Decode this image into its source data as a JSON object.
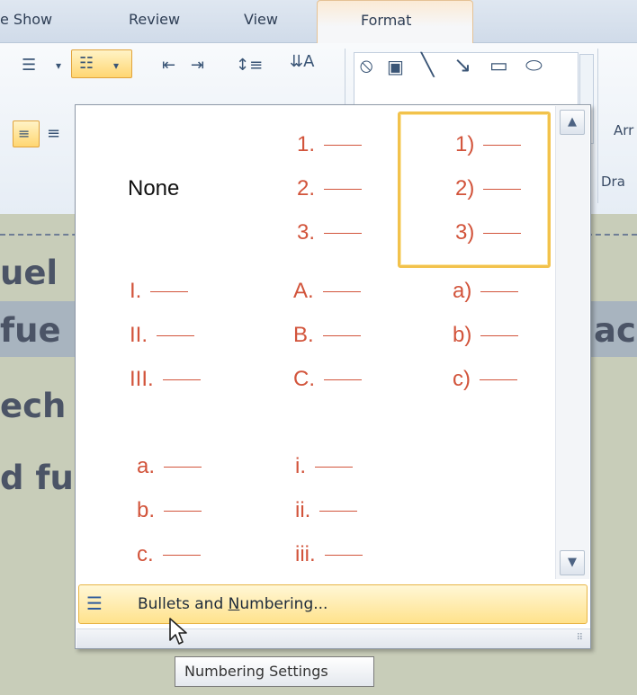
{
  "ribbon": {
    "tabs": [
      "e Show",
      "Review",
      "View"
    ],
    "active_tab": "Format",
    "group_labels": [
      "Arr",
      "Dra"
    ]
  },
  "background_text": [
    "uel",
    "fue",
    "ech",
    "d fu",
    "ac"
  ],
  "numbering_gallery": {
    "none_label": "None",
    "selected_index": 2,
    "formats": [
      {
        "id": "none",
        "items": []
      },
      {
        "id": "numeric-period",
        "items": [
          "1.",
          "2.",
          "3."
        ]
      },
      {
        "id": "numeric-paren",
        "items": [
          "1)",
          "2)",
          "3)"
        ]
      },
      {
        "id": "roman-upper",
        "items": [
          "I.",
          "II.",
          "III."
        ]
      },
      {
        "id": "alpha-upper",
        "items": [
          "A.",
          "B.",
          "C."
        ]
      },
      {
        "id": "alpha-lower-paren",
        "items": [
          "a)",
          "b)",
          "c)"
        ]
      },
      {
        "id": "alpha-lower-period",
        "items": [
          "a.",
          "b.",
          "c."
        ]
      },
      {
        "id": "roman-lower",
        "items": [
          "i.",
          "ii.",
          "iii."
        ]
      }
    ],
    "footer_label": "Bullets and Numbering...",
    "footer_mnemonic": "N"
  },
  "tooltip": "Numbering Settings",
  "colors": {
    "accent": "#f2c24c",
    "item_text": "#d2543b"
  }
}
